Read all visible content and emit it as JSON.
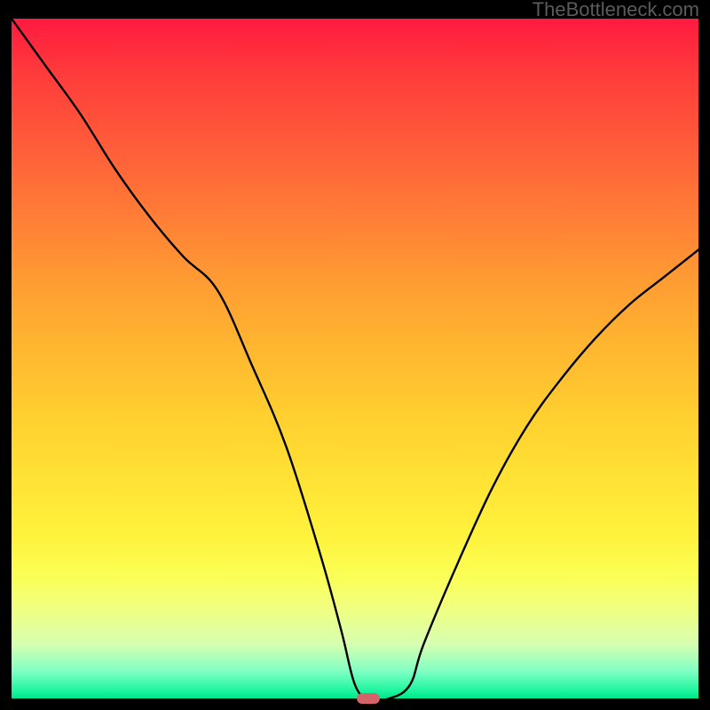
{
  "watermark": "TheBottleneck.com",
  "chart_data": {
    "type": "line",
    "title": "",
    "xlabel": "",
    "ylabel": "",
    "xlim": [
      0,
      100
    ],
    "ylim": [
      0,
      100
    ],
    "x": [
      0,
      5,
      10,
      15,
      20,
      25,
      30,
      35,
      40,
      45,
      48,
      50,
      52,
      55,
      58,
      60,
      65,
      70,
      75,
      80,
      85,
      90,
      95,
      100
    ],
    "values": [
      100,
      93,
      86,
      78,
      71,
      65,
      60,
      49,
      37,
      21,
      10,
      2,
      0,
      0,
      2,
      8,
      20,
      31,
      40,
      47,
      53,
      58,
      62,
      66
    ],
    "marker": {
      "x": 52,
      "y": 0
    },
    "gradient_stops": [
      {
        "t": 0.0,
        "color": "#ff1a40"
      },
      {
        "t": 0.5,
        "color": "#ffce2f"
      },
      {
        "t": 0.85,
        "color": "#f3ff7a"
      },
      {
        "t": 1.0,
        "color": "#00e58a"
      }
    ]
  }
}
